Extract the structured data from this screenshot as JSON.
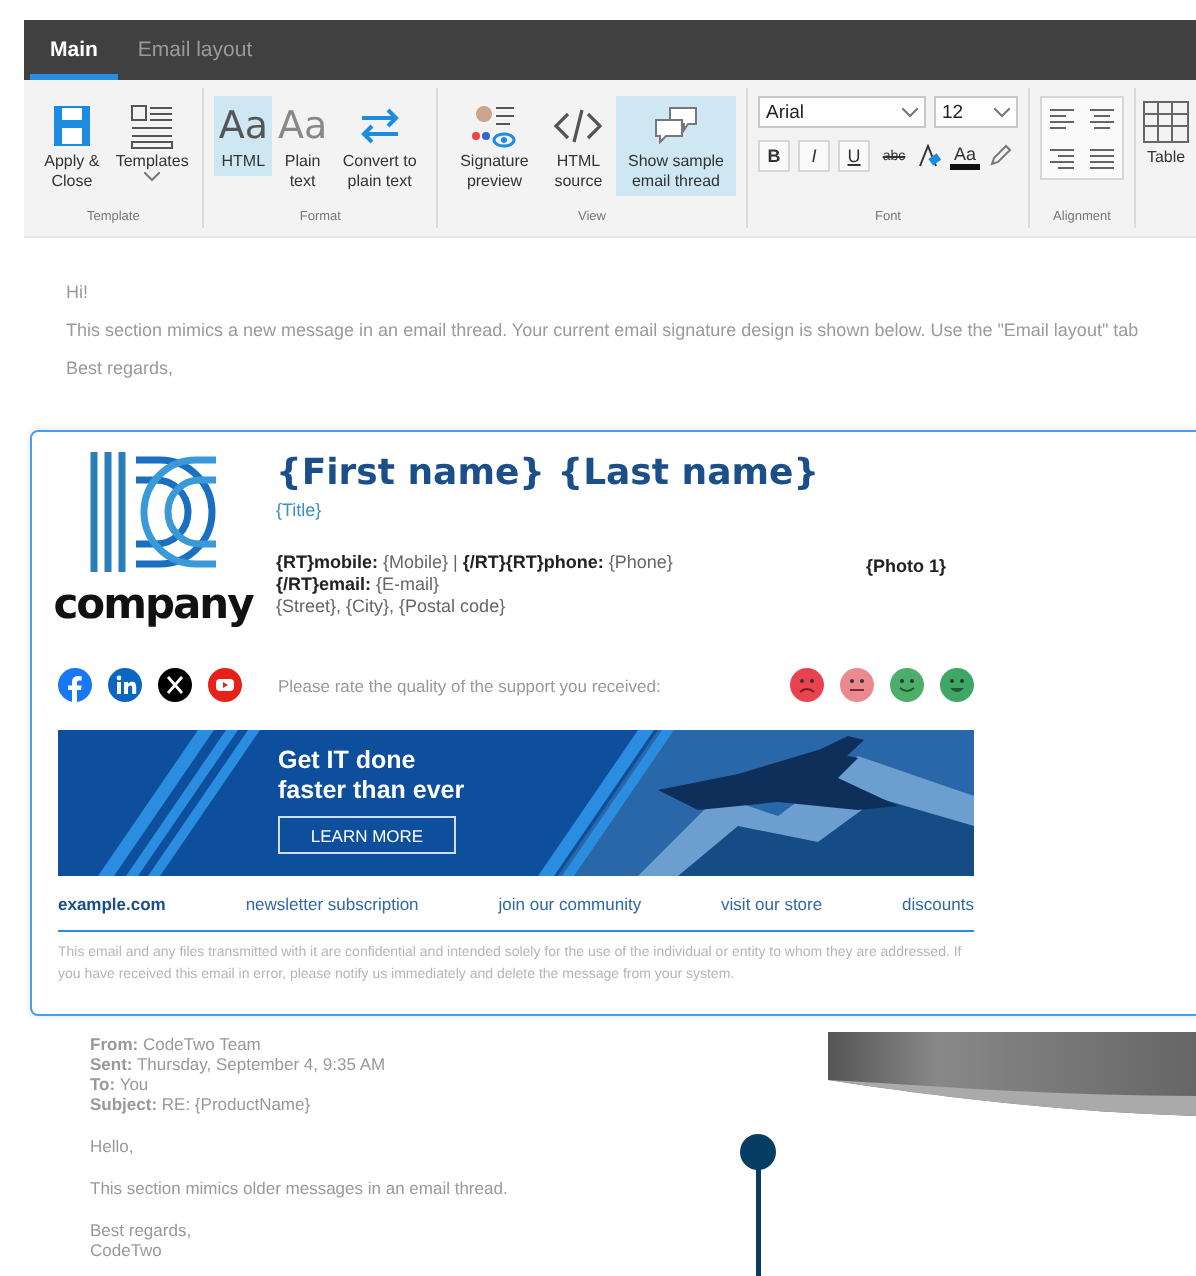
{
  "tabs": [
    {
      "label": "Main",
      "selected": true
    },
    {
      "label": "Email layout",
      "selected": false
    }
  ],
  "ribbon": {
    "groups": [
      {
        "label": "Template",
        "items": [
          {
            "kind": "save",
            "label": "Apply & Close",
            "selected": false
          },
          {
            "kind": "templates",
            "label": "Templates",
            "selected": false
          }
        ]
      },
      {
        "label": "Format",
        "items": [
          {
            "kind": "html",
            "label": "HTML",
            "selected": true,
            "icon_text": "Aa"
          },
          {
            "kind": "plain",
            "label": "Plain text",
            "selected": false,
            "icon_text": "Aa"
          },
          {
            "kind": "convert",
            "label": "Convert to plain text",
            "selected": false
          }
        ]
      },
      {
        "label": "View",
        "items": [
          {
            "kind": "preview",
            "label": "Signature preview",
            "selected": false
          },
          {
            "kind": "source",
            "label": "HTML source",
            "selected": false
          },
          {
            "kind": "thread",
            "label": "Show sample email thread",
            "selected": true
          }
        ]
      }
    ],
    "font": {
      "label": "Font",
      "family": "Arial",
      "size": "12",
      "format_buttons": [
        "B",
        "I",
        "U",
        "abc"
      ],
      "color_button": "Aa"
    },
    "alignment": {
      "label": "Alignment"
    },
    "table": {
      "label": "Table"
    }
  },
  "message": {
    "greeting": "Hi!",
    "body": "This section mimics a new message in an email thread. Your current email signature design is shown below. Use the \"Email layout\" tab",
    "closing": "Best regards,"
  },
  "signature": {
    "logo_text": "company",
    "name": "{First name} {Last name}",
    "title": "{Title}",
    "photo": "{Photo 1}",
    "contact_lines": [
      "**{RT}mobile:** {Mobile}  |  **{/RT}{RT}phone:** {Phone}",
      "**{/RT}email:** {E-mail}",
      "{Street}, {City}, {Postal code}"
    ],
    "rating_prompt": "Please rate the quality of the support you received:",
    "rating_faces": [
      {
        "kind": "sad",
        "color": "#e8434f"
      },
      {
        "kind": "neutral",
        "color": "#ea8a90"
      },
      {
        "kind": "smile",
        "color": "#4cae6a"
      },
      {
        "kind": "grin",
        "color": "#3ea765"
      }
    ],
    "banner": {
      "headline": [
        "Get IT done",
        "faster than ever"
      ],
      "button": "LEARN MORE"
    },
    "links": [
      {
        "kind": "site",
        "label": "example.com"
      },
      {
        "kind": "link",
        "label": "newsletter subscription"
      },
      {
        "kind": "link",
        "label": "join our community"
      },
      {
        "kind": "link",
        "label": "visit our store"
      },
      {
        "kind": "link",
        "label": "discounts"
      }
    ],
    "disclaimer": "This email and any files transmitted with it are confidential and intended solely for the use of the individual or entity to whom they are addressed. If you have received this email in error, please notify us immediately and delete the message from your system."
  },
  "quoted": {
    "headers": [
      {
        "label": "From:",
        "value": "CodeTwo Team"
      },
      {
        "label": "Sent:",
        "value": "Thursday, September 4, 9:35 AM"
      },
      {
        "label": "To:",
        "value": "You"
      },
      {
        "label": "Subject:",
        "value": "RE: {ProductName}"
      }
    ],
    "greeting": "Hello,",
    "body": "This section mimics older messages in an email thread.",
    "closing": [
      "Best regards,",
      "CodeTwo"
    ]
  }
}
